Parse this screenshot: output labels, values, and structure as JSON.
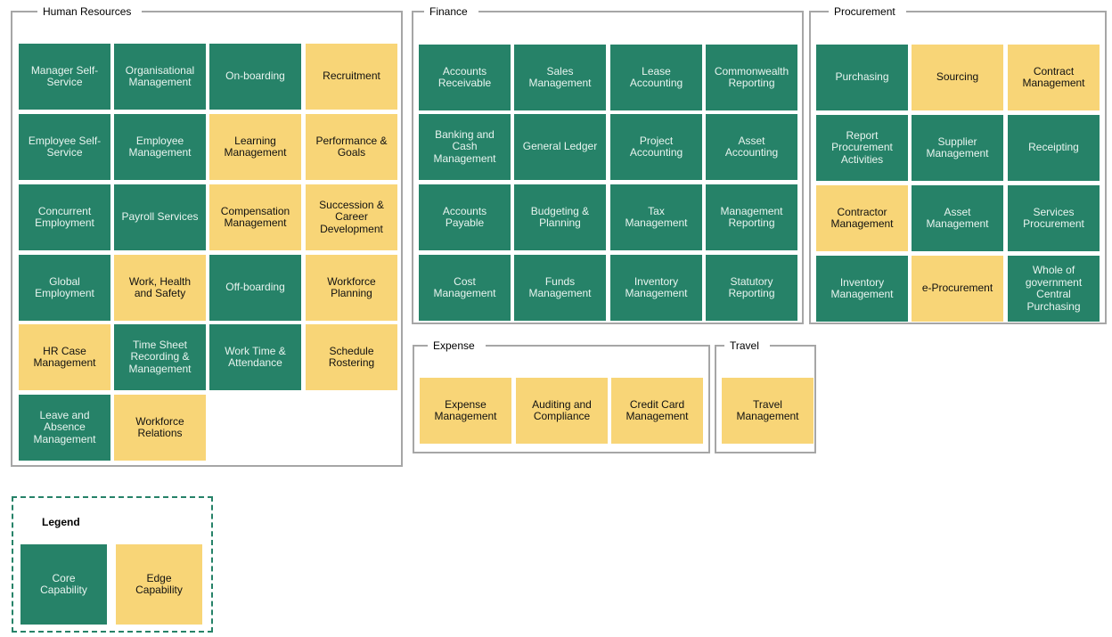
{
  "colors": {
    "core": "#268268",
    "edge": "#f8d577",
    "border": "#a6a6a6"
  },
  "groups": [
    {
      "id": "human-resources",
      "title": "Human Resources",
      "cols": 4,
      "tiles": [
        {
          "label": "Manager Self-Service",
          "type": "core"
        },
        {
          "label": "Organisational Management",
          "type": "core"
        },
        {
          "label": "On-boarding",
          "type": "core"
        },
        {
          "label": "Recruitment",
          "type": "edge"
        },
        {
          "label": "Employee Self-Service",
          "type": "core"
        },
        {
          "label": "Employee Management",
          "type": "core"
        },
        {
          "label": "Learning Management",
          "type": "edge"
        },
        {
          "label": "Performance & Goals",
          "type": "edge"
        },
        {
          "label": "Concurrent Employment",
          "type": "core"
        },
        {
          "label": "Payroll Services",
          "type": "core"
        },
        {
          "label": "Compensation Management",
          "type": "edge"
        },
        {
          "label": "Succession & Career Development",
          "type": "edge"
        },
        {
          "label": "Global Employment",
          "type": "core"
        },
        {
          "label": "Work, Health and Safety",
          "type": "edge"
        },
        {
          "label": "Off-boarding",
          "type": "core"
        },
        {
          "label": "Workforce Planning",
          "type": "edge"
        },
        {
          "label": "HR Case Management",
          "type": "edge"
        },
        {
          "label": "Time Sheet Recording & Management",
          "type": "core"
        },
        {
          "label": "Work Time & Attendance",
          "type": "core"
        },
        {
          "label": "Schedule Rostering",
          "type": "edge"
        },
        {
          "label": "Leave and Absence Management",
          "type": "core"
        },
        {
          "label": "Workforce Relations",
          "type": "edge"
        }
      ]
    },
    {
      "id": "finance",
      "title": "Finance",
      "cols": 4,
      "tiles": [
        {
          "label": "Accounts Receivable",
          "type": "core"
        },
        {
          "label": "Sales Management",
          "type": "core"
        },
        {
          "label": "Lease Accounting",
          "type": "core"
        },
        {
          "label": "Commonwealth Reporting",
          "type": "core"
        },
        {
          "label": "Banking and Cash Management",
          "type": "core"
        },
        {
          "label": "General Ledger",
          "type": "core"
        },
        {
          "label": "Project Accounting",
          "type": "core"
        },
        {
          "label": "Asset Accounting",
          "type": "core"
        },
        {
          "label": "Accounts Payable",
          "type": "core"
        },
        {
          "label": "Budgeting & Planning",
          "type": "core"
        },
        {
          "label": "Tax Management",
          "type": "core"
        },
        {
          "label": "Management Reporting",
          "type": "core"
        },
        {
          "label": "Cost Management",
          "type": "core"
        },
        {
          "label": "Funds Management",
          "type": "core"
        },
        {
          "label": "Inventory Management",
          "type": "core"
        },
        {
          "label": "Statutory Reporting",
          "type": "core"
        }
      ]
    },
    {
      "id": "procurement",
      "title": "Procurement",
      "cols": 3,
      "tiles": [
        {
          "label": "Purchasing",
          "type": "core"
        },
        {
          "label": "Sourcing",
          "type": "edge"
        },
        {
          "label": "Contract Management",
          "type": "edge"
        },
        {
          "label": "Report Procurement Activities",
          "type": "core"
        },
        {
          "label": "Supplier Management",
          "type": "core"
        },
        {
          "label": "Receipting",
          "type": "core"
        },
        {
          "label": "Contractor Management",
          "type": "edge"
        },
        {
          "label": "Asset Management",
          "type": "core"
        },
        {
          "label": "Services Procurement",
          "type": "core"
        },
        {
          "label": "Inventory Management",
          "type": "core"
        },
        {
          "label": "e-Procurement",
          "type": "edge"
        },
        {
          "label": "Whole of government Central Purchasing",
          "type": "core"
        }
      ]
    },
    {
      "id": "expense",
      "title": "Expense",
      "cols": 3,
      "tiles": [
        {
          "label": "Expense Management",
          "type": "edge"
        },
        {
          "label": "Auditing and Compliance",
          "type": "edge"
        },
        {
          "label": "Credit Card Management",
          "type": "edge"
        }
      ]
    },
    {
      "id": "travel",
      "title": "Travel",
      "cols": 1,
      "tiles": [
        {
          "label": "Travel Management",
          "type": "edge"
        }
      ]
    }
  ],
  "legend": {
    "title": "Legend",
    "items": [
      {
        "label": "Core Capability",
        "type": "core"
      },
      {
        "label": "Edge Capability",
        "type": "edge"
      }
    ]
  }
}
